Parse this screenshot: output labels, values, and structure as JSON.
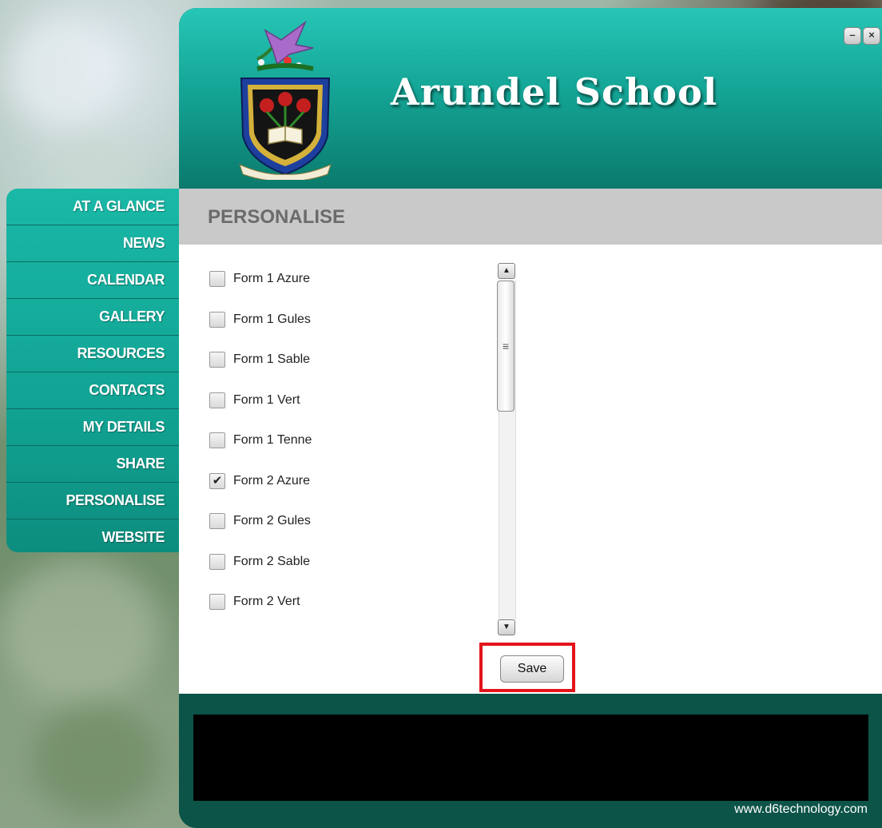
{
  "window": {
    "title": "Arundel School",
    "minimize_icon": "minimize-icon",
    "close_icon": "close-icon",
    "minimize_glyph": "–",
    "close_glyph": "×"
  },
  "colors": {
    "header_teal": "#14a596",
    "footer_green": "#0c5348",
    "section_bar": "#c9c9c9",
    "highlight_red": "#e3141b"
  },
  "sidebar": {
    "items": [
      {
        "label": "AT A GLANCE"
      },
      {
        "label": "NEWS"
      },
      {
        "label": "CALENDAR"
      },
      {
        "label": "GALLERY"
      },
      {
        "label": "RESOURCES"
      },
      {
        "label": "CONTACTS"
      },
      {
        "label": "MY DETAILS"
      },
      {
        "label": "SHARE"
      },
      {
        "label": "PERSONALISE"
      },
      {
        "label": "WEBSITE"
      }
    ]
  },
  "section": {
    "title": "PERSONALISE"
  },
  "list": {
    "items": [
      {
        "label": "Form 1 Azure",
        "checked": false
      },
      {
        "label": "Form 1 Gules",
        "checked": false
      },
      {
        "label": "Form 1 Sable",
        "checked": false
      },
      {
        "label": "Form 1 Vert",
        "checked": false
      },
      {
        "label": "Form 1 Tenne",
        "checked": false
      },
      {
        "label": "Form 2 Azure",
        "checked": true
      },
      {
        "label": "Form 2 Gules",
        "checked": false
      },
      {
        "label": "Form 2 Sable",
        "checked": false
      },
      {
        "label": "Form 2 Vert",
        "checked": false
      },
      {
        "label": "",
        "checked": false
      }
    ],
    "check_glyph": "✔",
    "scroll_up_glyph": "▲",
    "scroll_down_glyph": "▼",
    "thumb_grip_glyph": "≡"
  },
  "actions": {
    "save_label": "Save"
  },
  "footer": {
    "credit": "www.d6technology.com"
  }
}
